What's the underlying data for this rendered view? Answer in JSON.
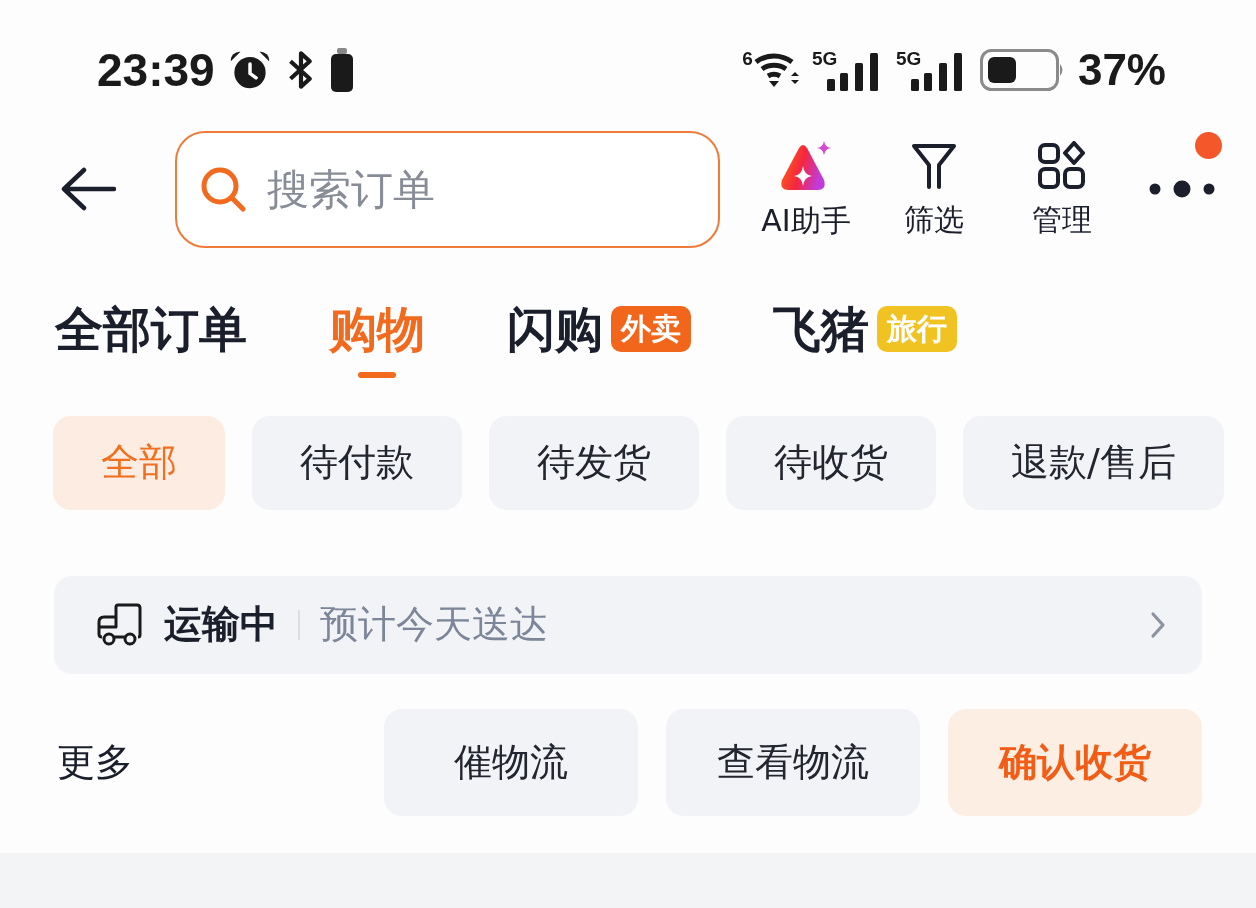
{
  "status_bar": {
    "time": "23:39",
    "wifi_label": "6",
    "signals": [
      {
        "label": "5G"
      },
      {
        "label": "5G"
      }
    ],
    "battery": "37%"
  },
  "header": {
    "search": {
      "placeholder": "搜索订单"
    },
    "actions": [
      {
        "kind": "ai",
        "label": "AI助手"
      },
      {
        "kind": "filter",
        "label": "筛选"
      },
      {
        "kind": "manage",
        "label": "管理"
      },
      {
        "kind": "more",
        "notification": true
      }
    ]
  },
  "tabs": [
    {
      "label": "全部订单",
      "selected": false
    },
    {
      "label": "购物",
      "selected": true
    },
    {
      "label": "闪购",
      "selected": false,
      "badge": {
        "label": "外卖",
        "color": "#f2661c"
      }
    },
    {
      "label": "飞猪",
      "selected": false,
      "badge": {
        "label": "旅行",
        "color": "#f0c322"
      }
    }
  ],
  "filters": [
    {
      "label": "全部",
      "selected": true
    },
    {
      "label": "待付款",
      "selected": false
    },
    {
      "label": "待发货",
      "selected": false
    },
    {
      "label": "待收货",
      "selected": false
    },
    {
      "label": "退款/售后",
      "selected": false
    }
  ],
  "order": {
    "status": "运输中",
    "detail": "预计今天送达",
    "more_label": "更多",
    "buttons": [
      {
        "label": "催物流",
        "kind": "secondary"
      },
      {
        "label": "查看物流",
        "kind": "secondary"
      },
      {
        "label": "确认收货",
        "kind": "primary"
      }
    ]
  }
}
